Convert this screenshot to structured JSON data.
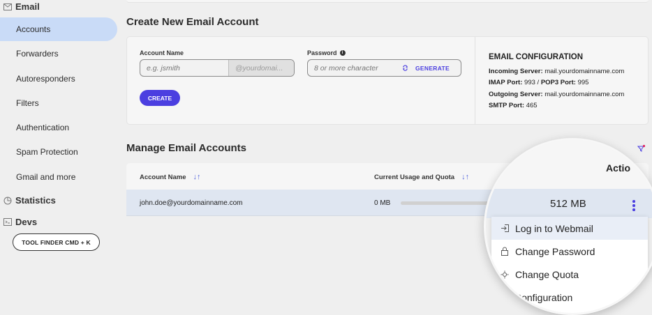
{
  "sidebar": {
    "email_section": "Email",
    "items": [
      {
        "label": "Accounts",
        "active": true
      },
      {
        "label": "Forwarders"
      },
      {
        "label": "Autoresponders"
      },
      {
        "label": "Filters"
      },
      {
        "label": "Authentication"
      },
      {
        "label": "Spam Protection"
      },
      {
        "label": "Gmail and more"
      }
    ],
    "statistics_section": "Statistics",
    "devs_section": "Devs",
    "tool_finder": "TOOL FINDER CMD + K"
  },
  "create": {
    "title": "Create New Email Account",
    "account_name_label": "Account Name",
    "account_name_placeholder": "e.g. jsmith",
    "domain_suffix": "@yourdomai...",
    "password_label": "Password",
    "password_placeholder": "8 or more character",
    "generate_label": "GENERATE",
    "create_button": "CREATE"
  },
  "config": {
    "title": "EMAIL CONFIGURATION",
    "incoming_label": "Incoming Server:",
    "incoming_value": "mail.yourdomainname.com",
    "imap_label": "IMAP Port:",
    "imap_value": "993",
    "pop3_label": "POP3 Port:",
    "pop3_value": "995",
    "outgoing_label": "Outgoing Server:",
    "outgoing_value": "mail.yourdomainname.com",
    "smtp_label": "SMTP Port:",
    "smtp_value": "465",
    "imap_separator": "/"
  },
  "manage": {
    "title": "Manage Email Accounts",
    "columns": [
      "Account Name",
      "Current Usage and Quota",
      "Actio"
    ],
    "rows": [
      {
        "account": "john.doe@yourdomainname.com",
        "usage": "0 MB",
        "quota": "512 MB",
        "usage_fraction": 0.0
      }
    ]
  },
  "actions_menu": {
    "items": [
      {
        "label": "Log in to Webmail",
        "icon": "login-icon"
      },
      {
        "label": "Change Password",
        "icon": "lock-icon"
      },
      {
        "label": "Change Quota",
        "icon": "quota-icon"
      },
      {
        "label": "l Configuration",
        "icon": "config-icon"
      }
    ]
  },
  "colors": {
    "accent": "#4b3fe0",
    "active_nav": "#c9dbf7",
    "row_highlight": "#dfe6f1"
  }
}
